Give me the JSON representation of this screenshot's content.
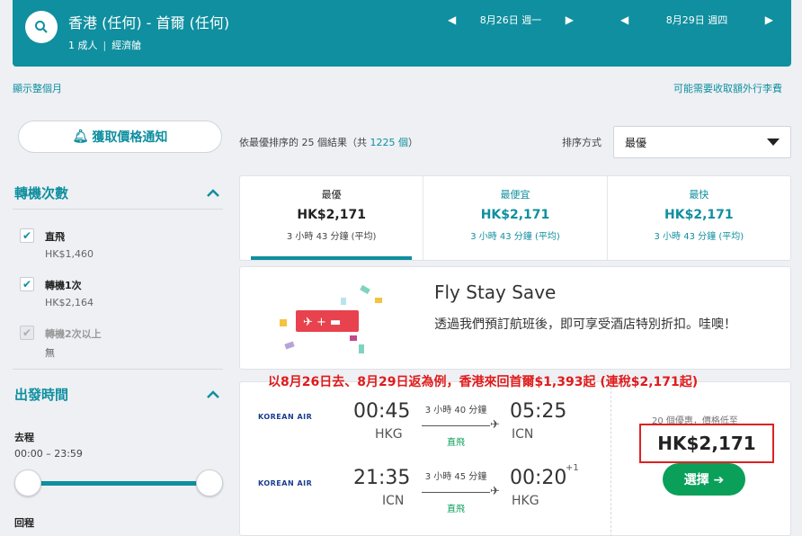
{
  "header": {
    "route": "香港 (任何) - 首爾 (任何)",
    "passengers": "1 成人",
    "cabin": "經濟艙",
    "depart_date": "8月26日 週一",
    "return_date": "8月29日 週四"
  },
  "links": {
    "show_month": "顯示整個月",
    "baggage_fees": "可能需要收取額外行李費"
  },
  "sidebar": {
    "price_alert": "獲取價格通知",
    "stops_title": "轉機次數",
    "stops": [
      {
        "label": "直飛",
        "price": "HK$1,460",
        "checked": true,
        "disabled": false
      },
      {
        "label": "轉機1次",
        "price": "HK$2,164",
        "checked": true,
        "disabled": false
      },
      {
        "label": "轉機2次以上",
        "price": "無",
        "checked": true,
        "disabled": true
      }
    ],
    "times_title": "出發時間",
    "outbound_label": "去程",
    "outbound_range": "00:00 – 23:59",
    "return_label": "回程"
  },
  "results": {
    "count_prefix": "依最優排序的 25 個結果（共 ",
    "count_total": "1225 個",
    "count_suffix": "）",
    "sort_label": "排序方式",
    "sort_value": "最優"
  },
  "tabs": [
    {
      "title": "最優",
      "price": "HK$2,171",
      "duration": "3 小時 43 分鐘 (平均)"
    },
    {
      "title": "最便宜",
      "price": "HK$2,171",
      "duration": "3 小時 43 分鐘 (平均)"
    },
    {
      "title": "最快",
      "price": "HK$2,171",
      "duration": "3 小時 43 分鐘 (平均)"
    }
  ],
  "promo": {
    "title": "Fly Stay Save",
    "text": "透過我們預訂航班後，即可享受酒店特別折扣。哇噢！"
  },
  "annotation": "以8月26日去、8月29日返為例，香港來回首爾$1,393起 (連稅$2,171起)",
  "flight": {
    "airline": "KOREAN AIR",
    "legs": [
      {
        "dep_time": "00:45",
        "dep_code": "HKG",
        "duration": "3 小時 40 分鐘",
        "stops": "直飛",
        "arr_time": "05:25",
        "arr_code": "ICN",
        "day_offset": ""
      },
      {
        "dep_time": "21:35",
        "dep_code": "ICN",
        "duration": "3 小時 45 分鐘",
        "stops": "直飛",
        "arr_time": "00:20",
        "arr_code": "HKG",
        "day_offset": "+1"
      }
    ],
    "deals": "20 個優惠，價格低至",
    "price": "HK$2,171",
    "select": "選擇 ➔"
  },
  "colors": {
    "brand": "#0f8f9f",
    "green": "#0aa05a",
    "annotation_red": "#e01b1b"
  }
}
